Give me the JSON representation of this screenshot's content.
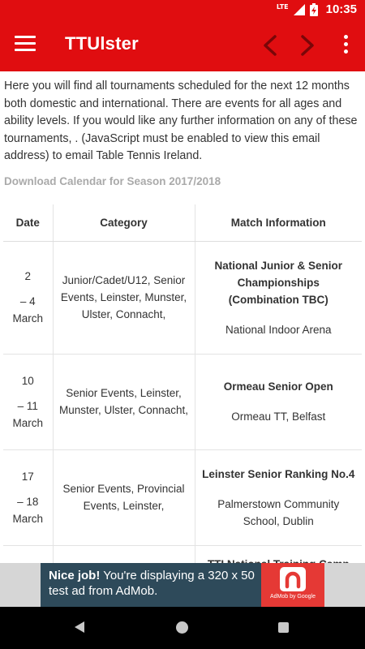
{
  "status_bar": {
    "network": "LTE",
    "time": "10:35"
  },
  "app_bar": {
    "title": "TTUlster"
  },
  "intro_text": "Here you will find all tournaments scheduled for the next 12 months both domestic and international. There are events for all ages and ability levels. If you would like any further information on any of these tournaments, . (JavaScript must be enabled to view this email address) to email Table Tennis Ireland.",
  "download_link": "Download Calendar for Season 2017/2018",
  "table": {
    "headers": {
      "date": "Date",
      "category": "Category",
      "info": "Match Information"
    },
    "rows": [
      {
        "date_start": "2",
        "date_end": "– 4",
        "month": "March",
        "category": "Junior/Cadet/U12, Senior Events, Leinster, Munster, Ulster, Connacht,",
        "event": "National Junior & Senior Championships (Combination TBC)",
        "venue": "National Indoor Arena"
      },
      {
        "date_start": "10",
        "date_end": "– 11",
        "month": "March",
        "category": "Senior Events, Leinster, Munster, Ulster, Connacht,",
        "event": "Ormeau Senior Open",
        "venue": "Ormeau TT, Belfast"
      },
      {
        "date_start": "17",
        "date_end": "– 18",
        "month": "March",
        "category": "Senior Events, Provincial Events, Leinster,",
        "event": "Leinster Senior Ranking No.4",
        "venue": "Palmerstown Community School, Dublin"
      },
      {
        "date_start": "",
        "date_end": "",
        "month": "",
        "category": "",
        "event": "TTI National Training Camp",
        "venue": ""
      }
    ]
  },
  "ad": {
    "headline": "Nice job!",
    "body": " You're displaying a 320 x 50 test ad from AdMob.",
    "logo_caption": "AdMob by Google"
  },
  "colors": {
    "primary": "#e00d10",
    "ad_background": "#2e4a5a",
    "ad_logo": "#e53935"
  },
  "icons": [
    "menu-icon",
    "chevron-left-icon",
    "chevron-right-icon",
    "more-vert-icon",
    "lte-signal-icon",
    "battery-charging-icon",
    "back-icon",
    "home-icon",
    "recents-icon",
    "admob-logo-icon"
  ]
}
